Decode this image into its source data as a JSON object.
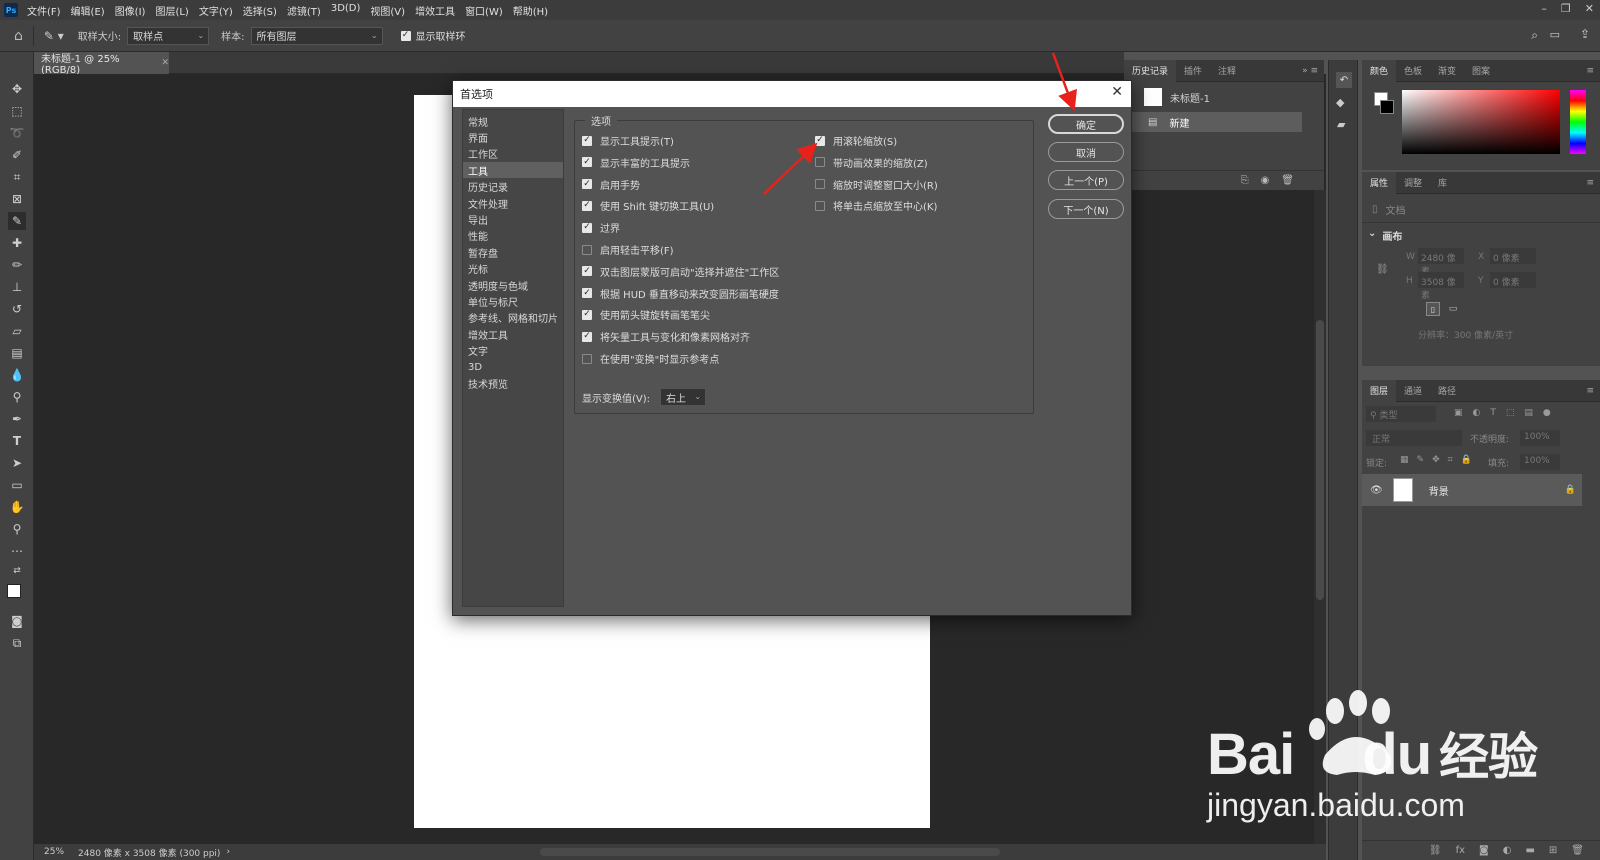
{
  "menubar": {
    "app_icon": "Ps",
    "items": [
      "文件(F)",
      "编辑(E)",
      "图像(I)",
      "图层(L)",
      "文字(Y)",
      "选择(S)",
      "滤镜(T)",
      "3D(D)",
      "视图(V)",
      "增效工具",
      "窗口(W)",
      "帮助(H)"
    ]
  },
  "options_bar": {
    "sample_size_label": "取样大小:",
    "sample_size_value": "取样点",
    "sample_label": "样本:",
    "sample_value": "所有图层",
    "show_ring_label": "显示取样环"
  },
  "document": {
    "tab_title": "未标题-1 @ 25%(RGB/8)",
    "zoom": "25%",
    "doc_info": "2480 像素 x 3508 像素 (300 ppi)"
  },
  "history_panel": {
    "tabs": [
      "历史记录",
      "插件",
      "注释"
    ],
    "snapshot_name": "未标题-1",
    "step_name": "新建"
  },
  "color_panel": {
    "tabs": [
      "颜色",
      "色板",
      "渐变",
      "图案"
    ]
  },
  "properties_panel": {
    "tabs": [
      "属性",
      "调整",
      "库"
    ],
    "doc_label": "文档",
    "canvas_section": "画布",
    "w_label": "W",
    "w_value": "2480 像素",
    "h_label": "H",
    "h_value": "3508 像素",
    "x_label": "X",
    "x_value": "0 像素",
    "y_label": "Y",
    "y_value": "0 像素",
    "resolution": "分辨率：300 像素/英寸"
  },
  "layers_panel": {
    "tabs": [
      "图层",
      "通道",
      "路径"
    ],
    "filter_placeholder": "类型",
    "blend_mode": "正常",
    "opacity_label": "不透明度:",
    "opacity_value": "100%",
    "lock_label": "锁定:",
    "fill_label": "填充:",
    "fill_value": "100%",
    "layer_name": "背景"
  },
  "dialog": {
    "title": "首选项",
    "categories": [
      "常规",
      "界面",
      "工作区",
      "工具",
      "历史记录",
      "文件处理",
      "导出",
      "性能",
      "暂存盘",
      "光标",
      "透明度与色域",
      "单位与标尺",
      "参考线、网格和切片",
      "增效工具",
      "文字",
      "3D",
      "技术预览"
    ],
    "active_category": "工具",
    "group_title": "选项",
    "left_options": [
      {
        "label": "显示工具提示(T)",
        "checked": true
      },
      {
        "label": "显示丰富的工具提示",
        "checked": true
      },
      {
        "label": "启用手势",
        "checked": true
      },
      {
        "label": "使用 Shift 键切换工具(U)",
        "checked": true
      },
      {
        "label": "过界",
        "checked": true
      },
      {
        "label": "启用轻击平移(F)",
        "checked": false
      },
      {
        "label": "双击图层蒙版可启动\"选择并遮住\"工作区",
        "checked": true
      },
      {
        "label": "根据 HUD 垂直移动来改变圆形画笔硬度",
        "checked": true
      },
      {
        "label": "使用箭头键旋转画笔笔尖",
        "checked": true
      },
      {
        "label": "将矢量工具与变化和像素网格对齐",
        "checked": true
      },
      {
        "label": "在使用\"变换\"时显示参考点",
        "checked": false
      }
    ],
    "right_options": [
      {
        "label": "用滚轮缩放(S)",
        "checked": true
      },
      {
        "label": "带动画效果的缩放(Z)",
        "checked": false
      },
      {
        "label": "缩放时调整窗口大小(R)",
        "checked": false
      },
      {
        "label": "将单击点缩放至中心(K)",
        "checked": false
      }
    ],
    "transform_value_label": "显示变换值(V):",
    "transform_value": "右上",
    "buttons": {
      "ok": "确定",
      "cancel": "取消",
      "prev": "上一个(P)",
      "next": "下一个(N)"
    }
  },
  "watermark": {
    "logo_text_bai": "Bai",
    "logo_text_du": "du",
    "logo_text_cn": "经验",
    "url": "jingyan.baidu.com"
  },
  "colors": {
    "annotation_arrow": "#e8221b",
    "baidu_watermark": "#ffffff"
  }
}
